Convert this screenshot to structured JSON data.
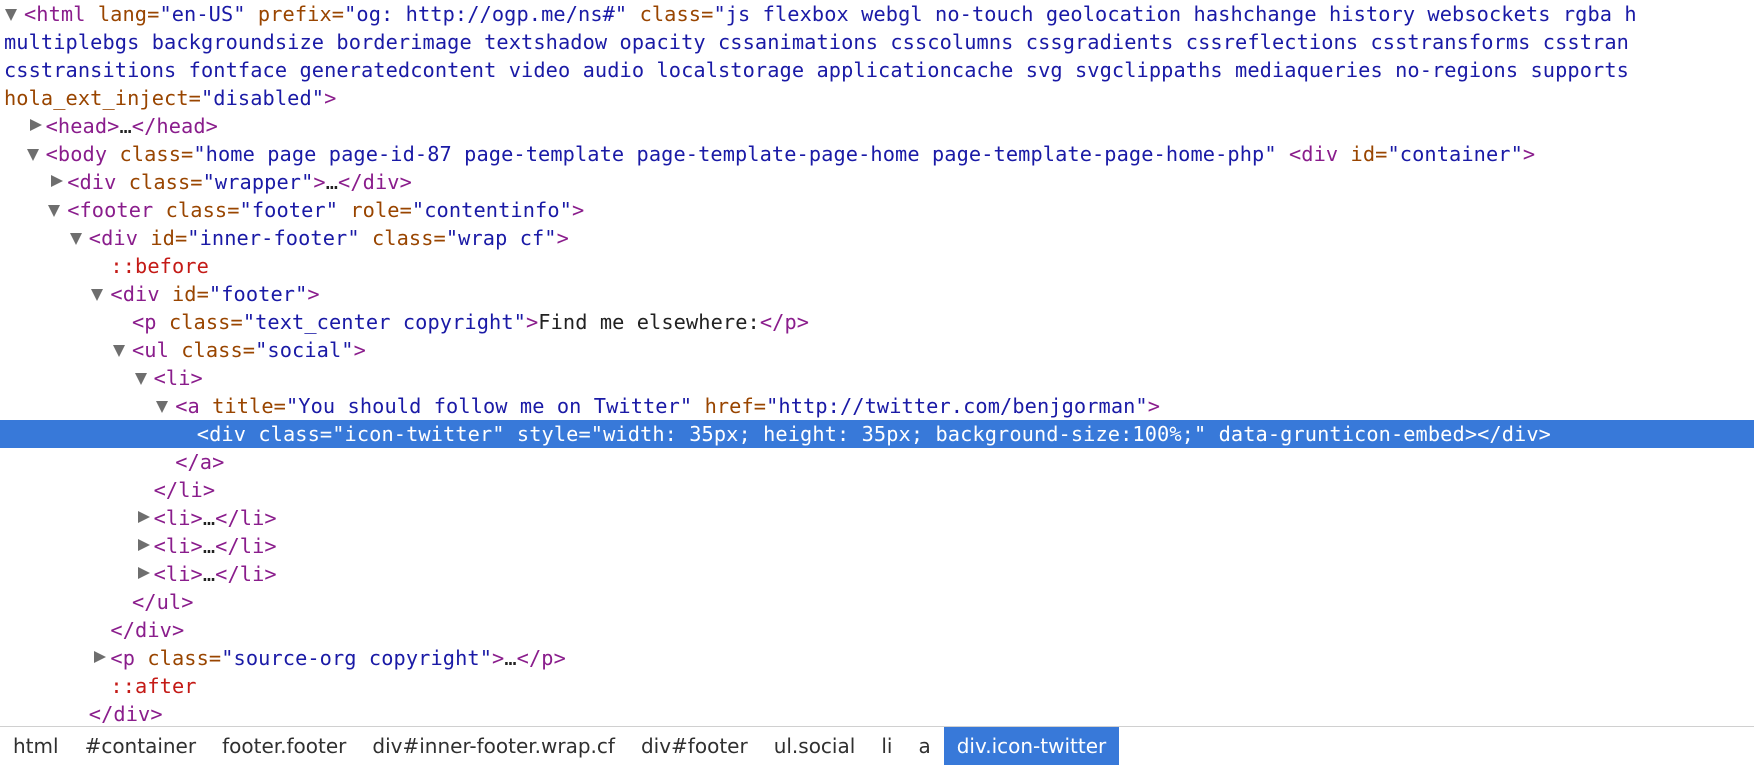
{
  "elements_tree": {
    "lines": [
      {
        "depth": 0,
        "tw": "open",
        "sel": false,
        "parts": [
          [
            "tg",
            "<html "
          ],
          [
            "an",
            "lang="
          ],
          [
            "av",
            "\"en-US\" "
          ],
          [
            "an",
            "prefix="
          ],
          [
            "av",
            "\"og: http://ogp.me/ns#\" "
          ],
          [
            "an",
            "class="
          ],
          [
            "av",
            "\"js flexbox webgl no-touch geolocation hashchange history websockets rgba h"
          ]
        ]
      },
      {
        "depth": -1,
        "tw": "none",
        "sel": false,
        "parts": [
          [
            "av",
            "multiplebgs backgroundsize borderimage textshadow opacity cssanimations csscolumns cssgradients cssreflections csstransforms csstran"
          ]
        ]
      },
      {
        "depth": -1,
        "tw": "none",
        "sel": false,
        "parts": [
          [
            "av",
            "csstransitions fontface generatedcontent video audio localstorage applicationcache svg svgclippaths mediaqueries no-regions supports"
          ]
        ]
      },
      {
        "depth": -1,
        "tw": "none",
        "sel": false,
        "parts": [
          [
            "an",
            "hola_ext_inject="
          ],
          [
            "av",
            "\"disabled\""
          ],
          [
            "tg",
            ">"
          ]
        ]
      },
      {
        "depth": 1,
        "tw": "closed",
        "sel": false,
        "parts": [
          [
            "tg",
            "<head>"
          ],
          [
            "pl",
            "…"
          ],
          [
            "tg",
            "</head>"
          ]
        ]
      },
      {
        "depth": 1,
        "tw": "open",
        "sel": false,
        "parts": [
          [
            "tg",
            "<body "
          ],
          [
            "an",
            "class="
          ],
          [
            "av",
            "\"home page page-id-87 page-template page-template-page-home page-template-page-home-php\" "
          ],
          [
            "tg",
            "<div "
          ],
          [
            "an",
            "id="
          ],
          [
            "av",
            "\"container\""
          ],
          [
            "tg",
            ">"
          ]
        ]
      },
      {
        "depth": 2,
        "tw": "closed",
        "sel": false,
        "parts": [
          [
            "tg",
            "<div "
          ],
          [
            "an",
            "class="
          ],
          [
            "av",
            "\"wrapper\""
          ],
          [
            "tg",
            ">"
          ],
          [
            "pl",
            "…"
          ],
          [
            "tg",
            "</div>"
          ]
        ]
      },
      {
        "depth": 2,
        "tw": "open",
        "sel": false,
        "parts": [
          [
            "tg",
            "<footer "
          ],
          [
            "an",
            "class="
          ],
          [
            "av",
            "\"footer\" "
          ],
          [
            "an",
            "role="
          ],
          [
            "av",
            "\"contentinfo\""
          ],
          [
            "tg",
            ">"
          ]
        ]
      },
      {
        "depth": 3,
        "tw": "open",
        "sel": false,
        "parts": [
          [
            "tg",
            "<div "
          ],
          [
            "an",
            "id="
          ],
          [
            "av",
            "\"inner-footer\" "
          ],
          [
            "an",
            "class="
          ],
          [
            "av",
            "\"wrap cf\""
          ],
          [
            "tg",
            ">"
          ]
        ]
      },
      {
        "depth": 4,
        "tw": "none",
        "sel": false,
        "parts": [
          [
            "ps",
            "::before"
          ]
        ]
      },
      {
        "depth": 4,
        "tw": "open",
        "sel": false,
        "parts": [
          [
            "tg",
            "<div "
          ],
          [
            "an",
            "id="
          ],
          [
            "av",
            "\"footer\""
          ],
          [
            "tg",
            ">"
          ]
        ]
      },
      {
        "depth": 5,
        "tw": "none",
        "sel": false,
        "parts": [
          [
            "tg",
            "<p "
          ],
          [
            "an",
            "class="
          ],
          [
            "av",
            "\"text_center copyright\""
          ],
          [
            "tg",
            ">"
          ],
          [
            "pl",
            "Find me elsewhere:"
          ],
          [
            "tg",
            "</p>"
          ]
        ]
      },
      {
        "depth": 5,
        "tw": "open",
        "sel": false,
        "parts": [
          [
            "tg",
            "<ul "
          ],
          [
            "an",
            "class="
          ],
          [
            "av",
            "\"social\""
          ],
          [
            "tg",
            ">"
          ]
        ]
      },
      {
        "depth": 6,
        "tw": "open",
        "sel": false,
        "parts": [
          [
            "tg",
            "<li>"
          ]
        ]
      },
      {
        "depth": 7,
        "tw": "open",
        "sel": false,
        "parts": [
          [
            "tg",
            "<a "
          ],
          [
            "an",
            "title="
          ],
          [
            "av",
            "\"You should follow me on Twitter\" "
          ],
          [
            "an",
            "href="
          ],
          [
            "av",
            "\"http://twitter.com/benjgorman\""
          ],
          [
            "tg",
            ">"
          ]
        ]
      },
      {
        "depth": 8,
        "tw": "none",
        "sel": true,
        "parts": [
          [
            "tg",
            "<div "
          ],
          [
            "an",
            "class="
          ],
          [
            "av",
            "\"icon-twitter\" "
          ],
          [
            "an",
            "style="
          ],
          [
            "av",
            "\"width: 35px; height: 35px; background-size:100%;\" "
          ],
          [
            "an",
            "data-grunticon-embed"
          ],
          [
            "tg",
            "></div>"
          ]
        ]
      },
      {
        "depth": 7,
        "tw": "none",
        "sel": false,
        "parts": [
          [
            "tg",
            "</a>"
          ]
        ]
      },
      {
        "depth": 6,
        "tw": "none",
        "sel": false,
        "parts": [
          [
            "tg",
            "</li>"
          ]
        ]
      },
      {
        "depth": 6,
        "tw": "closed",
        "sel": false,
        "parts": [
          [
            "tg",
            "<li>"
          ],
          [
            "pl",
            "…"
          ],
          [
            "tg",
            "</li>"
          ]
        ]
      },
      {
        "depth": 6,
        "tw": "closed",
        "sel": false,
        "parts": [
          [
            "tg",
            "<li>"
          ],
          [
            "pl",
            "…"
          ],
          [
            "tg",
            "</li>"
          ]
        ]
      },
      {
        "depth": 6,
        "tw": "closed",
        "sel": false,
        "parts": [
          [
            "tg",
            "<li>"
          ],
          [
            "pl",
            "…"
          ],
          [
            "tg",
            "</li>"
          ]
        ]
      },
      {
        "depth": 5,
        "tw": "none",
        "sel": false,
        "parts": [
          [
            "tg",
            "</ul>"
          ]
        ]
      },
      {
        "depth": 4,
        "tw": "none",
        "sel": false,
        "parts": [
          [
            "tg",
            "</div>"
          ]
        ]
      },
      {
        "depth": 4,
        "tw": "closed",
        "sel": false,
        "parts": [
          [
            "tg",
            "<p "
          ],
          [
            "an",
            "class="
          ],
          [
            "av",
            "\"source-org copyright\""
          ],
          [
            "tg",
            ">"
          ],
          [
            "pl",
            "…"
          ],
          [
            "tg",
            "</p>"
          ]
        ]
      },
      {
        "depth": 4,
        "tw": "none",
        "sel": false,
        "parts": [
          [
            "ps",
            "::after"
          ]
        ]
      },
      {
        "depth": 3,
        "tw": "none",
        "sel": false,
        "parts": [
          [
            "tg",
            "</div>"
          ]
        ]
      }
    ]
  },
  "breadcrumbs": {
    "items": [
      {
        "label": "html",
        "active": false
      },
      {
        "label": "#container",
        "active": false
      },
      {
        "label": "footer.footer",
        "active": false
      },
      {
        "label": "div#inner-footer.wrap.cf",
        "active": false
      },
      {
        "label": "div#footer",
        "active": false
      },
      {
        "label": "ul.social",
        "active": false
      },
      {
        "label": "li",
        "active": false
      },
      {
        "label": "a",
        "active": false
      },
      {
        "label": "div.icon-twitter",
        "active": true
      }
    ]
  },
  "colors": {
    "selection": "#3879d9",
    "tag": "#8a1d8c",
    "attr_name": "#994500",
    "attr_value": "#1a1aa6",
    "pseudo": "#c41a16"
  }
}
